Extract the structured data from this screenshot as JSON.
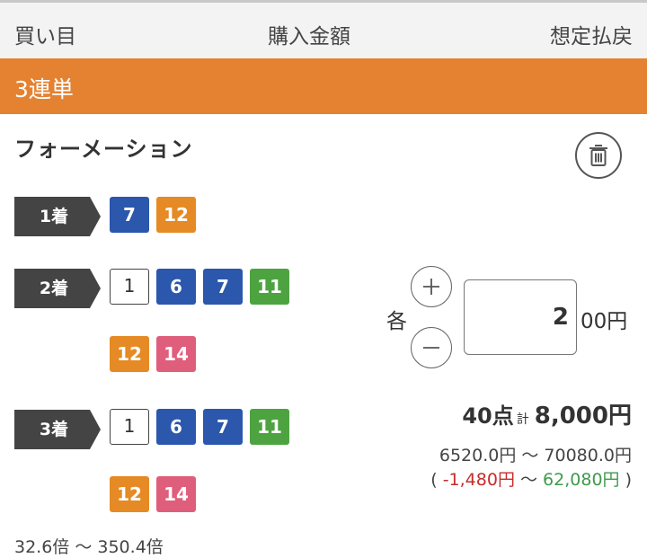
{
  "header": {
    "col_bet": "買い目",
    "col_amount": "購入金額",
    "col_payout": "想定払戻"
  },
  "section": {
    "title": "3連単"
  },
  "bet": {
    "type": "フォーメーション"
  },
  "positions": [
    {
      "label": "1着",
      "numbers": [
        {
          "n": "7",
          "color": "#2b57ad"
        },
        {
          "n": "12",
          "color": "#e58a24"
        }
      ]
    },
    {
      "label": "2着",
      "numbers": [
        {
          "n": "1",
          "color": "#ffffff"
        },
        {
          "n": "6",
          "color": "#2b57ad"
        },
        {
          "n": "7",
          "color": "#2b57ad"
        },
        {
          "n": "11",
          "color": "#4da340"
        },
        {
          "n": "12",
          "color": "#e58a24"
        },
        {
          "n": "14",
          "color": "#df5e7c"
        }
      ]
    },
    {
      "label": "3着",
      "numbers": [
        {
          "n": "1",
          "color": "#ffffff"
        },
        {
          "n": "6",
          "color": "#2b57ad"
        },
        {
          "n": "7",
          "color": "#2b57ad"
        },
        {
          "n": "11",
          "color": "#4da340"
        },
        {
          "n": "12",
          "color": "#e58a24"
        },
        {
          "n": "14",
          "color": "#df5e7c"
        }
      ]
    }
  ],
  "amount": {
    "each_label": "各",
    "value": "2",
    "unit": "00円"
  },
  "summary": {
    "points": "40点",
    "total_label": "計",
    "total": "8,000円",
    "payout_range": "6520.0円 ～ 70080.0円",
    "profit_open": "(",
    "profit_min": "-1,480円",
    "profit_sep": " ～ ",
    "profit_max": "62,080円",
    "profit_close": ")",
    "odds_range": "32.6倍 ～ 350.4倍"
  },
  "icons": {
    "delete": "trash-icon",
    "increment": "plus-icon",
    "decrement": "minus-icon",
    "position_tag": "arrow-tag-icon"
  },
  "colors": {
    "accent": "#e58232",
    "header_bg": "#f3f3f3",
    "label_tag": "#444444",
    "profit_negative": "#c62c2c",
    "profit_positive": "#3f9a4b"
  }
}
